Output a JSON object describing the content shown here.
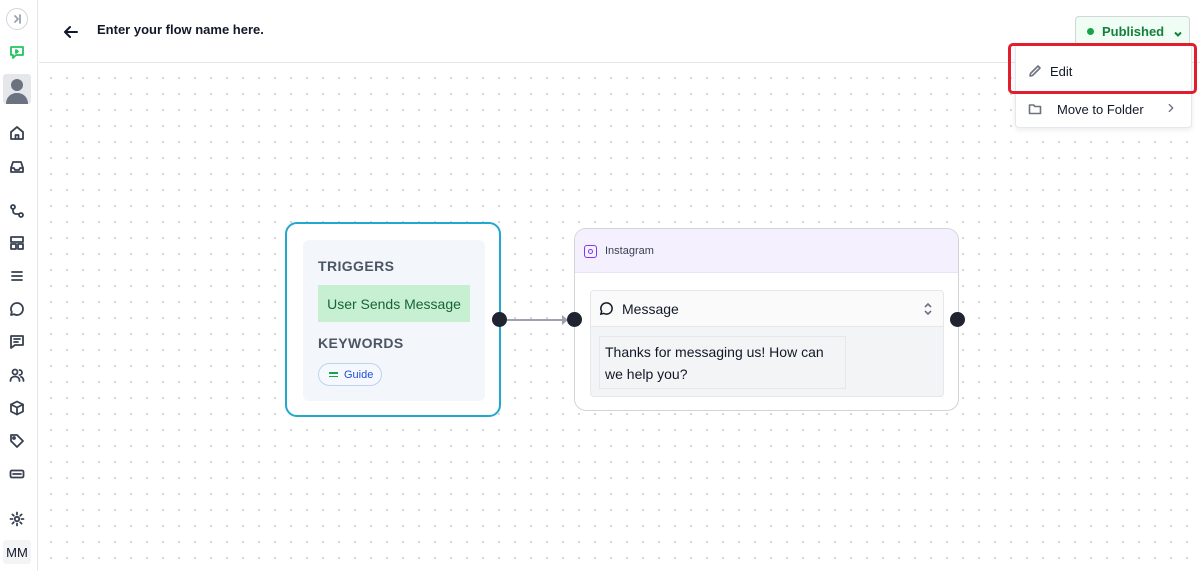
{
  "header": {
    "flow_name": "Enter your flow name here.",
    "status_label": "Published",
    "status_color": "#16a34a"
  },
  "sidebar": {
    "items": [
      {
        "icon": "collapse-icon"
      },
      {
        "icon": "flow-builder-icon"
      },
      {
        "icon": "user-avatar-icon"
      },
      {
        "icon": "home-icon"
      },
      {
        "icon": "inbox-icon"
      },
      {
        "icon": "flows-icon"
      },
      {
        "icon": "templates-icon"
      },
      {
        "icon": "list-icon"
      },
      {
        "icon": "chat-icon"
      },
      {
        "icon": "messages-icon"
      },
      {
        "icon": "contacts-icon"
      },
      {
        "icon": "box-icon"
      },
      {
        "icon": "tag-icon"
      },
      {
        "icon": "keyboard-icon"
      },
      {
        "icon": "settings-icon"
      }
    ],
    "initials": "MM"
  },
  "menu": {
    "items": [
      {
        "label": "Edit",
        "icon": "pencil-icon"
      },
      {
        "label": "Move to Folder",
        "icon": "folder-icon"
      }
    ],
    "highlight_color": "#e11d2e"
  },
  "trigger_node": {
    "triggers_title": "TRIGGERS",
    "trigger": "User Sends Message",
    "keywords_title": "KEYWORDS",
    "keyword": "Guide"
  },
  "instagram_node": {
    "channel": "Instagram",
    "block_type": "Message",
    "message": "Thanks for messaging us! How can we help you?"
  }
}
